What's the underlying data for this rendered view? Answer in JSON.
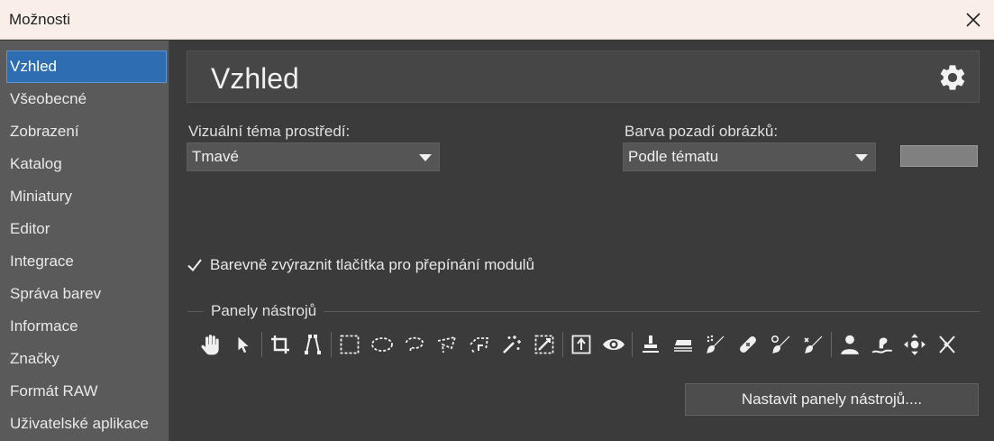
{
  "window": {
    "title": "Možnosti"
  },
  "sidebar": {
    "items": [
      {
        "label": "Vzhled",
        "active": true
      },
      {
        "label": "Všeobecné"
      },
      {
        "label": "Zobrazení"
      },
      {
        "label": "Katalog"
      },
      {
        "label": "Miniatury"
      },
      {
        "label": "Editor"
      },
      {
        "label": "Integrace"
      },
      {
        "label": "Správa barev"
      },
      {
        "label": "Informace"
      },
      {
        "label": "Značky"
      },
      {
        "label": "Formát RAW"
      },
      {
        "label": "Uživatelské aplikace"
      }
    ]
  },
  "main": {
    "title": "Vzhled",
    "theme": {
      "label": "Vizuální téma prostředí:",
      "value": "Tmavé"
    },
    "background": {
      "label": "Barva pozadí obrázků:",
      "value": "Podle tématu",
      "swatch_color": "#808080"
    },
    "highlight_checkbox": {
      "label": "Barevně zvýraznit tlačítka pro přepínání modulů",
      "checked": true
    },
    "toolbars": {
      "title": "Panely nástrojů",
      "configure_label": "Nastavit panely nástrojů....",
      "tools": [
        "hand-icon",
        "arrow-pointer-icon",
        "|",
        "crop-icon",
        "perspective-icon",
        "|",
        "rect-select-icon",
        "ellipse-select-icon",
        "lasso-icon",
        "polygon-lasso-icon",
        "magnetic-lasso-icon",
        "magic-wand-icon",
        "gradient-mask-icon",
        "|",
        "export-icon",
        "eye-icon",
        "|",
        "clone-stamp-icon",
        "eraser-icon",
        "spray-brush-icon",
        "bandage-icon",
        "brush-icon",
        "brush-alt-icon",
        "|",
        "person-icon",
        "smudge-icon",
        "move-icon",
        "warp-icon"
      ]
    }
  },
  "colors": {
    "accent": "#2f6db2",
    "panel": "#3b3b3b",
    "sidebar": "#5a5a5a"
  }
}
